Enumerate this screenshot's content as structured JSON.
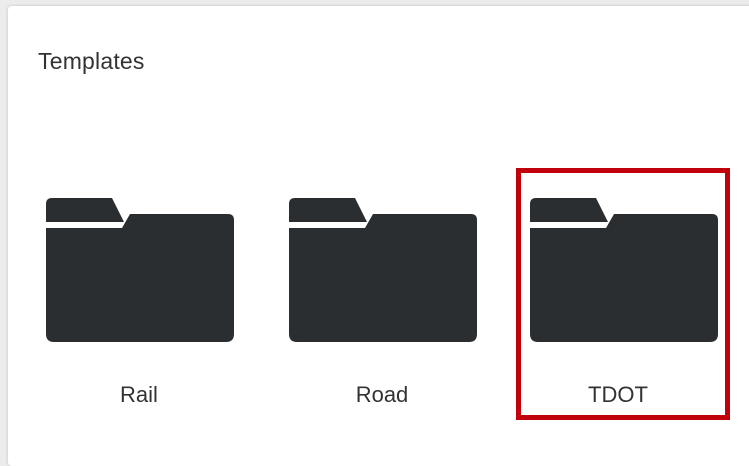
{
  "section": {
    "title": "Templates"
  },
  "templates": [
    {
      "label": "Rail",
      "icon": "folder-icon",
      "selected": false
    },
    {
      "label": "Road",
      "icon": "folder-icon",
      "selected": false
    },
    {
      "label": "TDOT",
      "icon": "folder-icon",
      "selected": true
    }
  ],
  "colors": {
    "folder": "#2b2e31",
    "selection_border": "#c0000a",
    "text": "#333333"
  }
}
